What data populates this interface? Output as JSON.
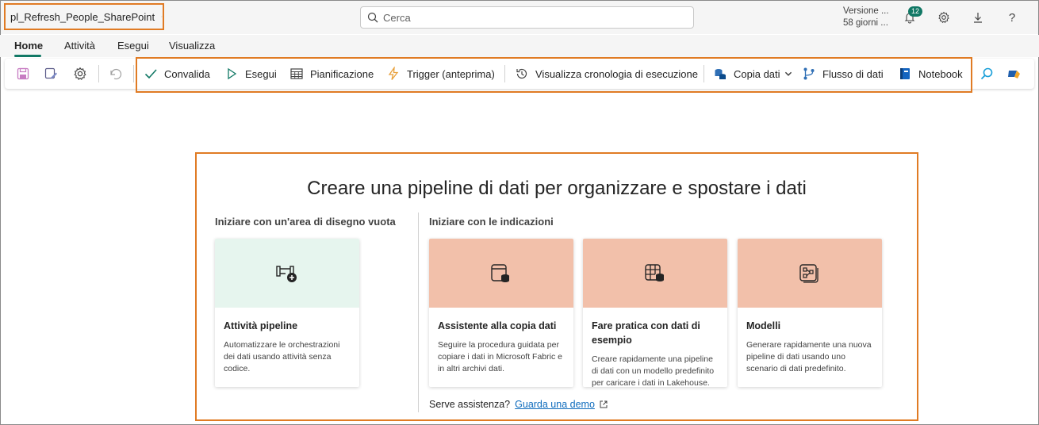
{
  "header": {
    "pipeline_name": "pl_Refresh_People_SharePoint",
    "search_placeholder": "Cerca",
    "version_line1": "Versione ...",
    "version_line2": "58 giorni ...",
    "notification_count": "12",
    "help_label": "?"
  },
  "tabs": [
    {
      "label": "Home",
      "active": true
    },
    {
      "label": "Attività"
    },
    {
      "label": "Esegui"
    },
    {
      "label": "Visualizza"
    }
  ],
  "ribbon": {
    "validate": "Convalida",
    "run": "Esegui",
    "schedule": "Pianificazione",
    "trigger": "Trigger (anteprima)",
    "history": "Visualizza cronologia di esecuzione",
    "copy_data": "Copia dati",
    "dataflow": "Flusso di dati",
    "notebook": "Notebook"
  },
  "main": {
    "heading": "Creare una pipeline di dati per organizzare e spostare i dati",
    "blank_section_title": "Iniziare con un'area di disegno vuota",
    "guided_section_title": "Iniziare con le indicazioni",
    "cards": [
      {
        "title": "Attività pipeline",
        "description": "Automatizzare le orchestrazioni dei dati usando attività senza codice.",
        "icon": "pipeline-activity-icon",
        "color": "#e6f5ee"
      },
      {
        "title": "Assistente alla copia dati",
        "description": "Seguire la procedura guidata per copiare i dati in Microsoft Fabric e in altri archivi dati.",
        "icon": "copy-assistant-icon",
        "color": "#f2c0aa"
      },
      {
        "title": "Fare pratica con dati di esempio",
        "description": "Creare rapidamente una pipeline di dati con un modello predefinito per caricare i dati in Lakehouse.",
        "icon": "sample-data-icon",
        "color": "#f2c0aa"
      },
      {
        "title": "Modelli",
        "description": "Generare rapidamente una nuova pipeline di dati usando uno scenario di dati predefinito.",
        "icon": "templates-icon",
        "color": "#f2c0aa"
      }
    ],
    "help_text": "Serve assistenza?",
    "help_link": "Guarda una demo"
  },
  "colors": {
    "highlight": "#e07b24",
    "accent": "#117865",
    "link": "#0f6cbd"
  }
}
